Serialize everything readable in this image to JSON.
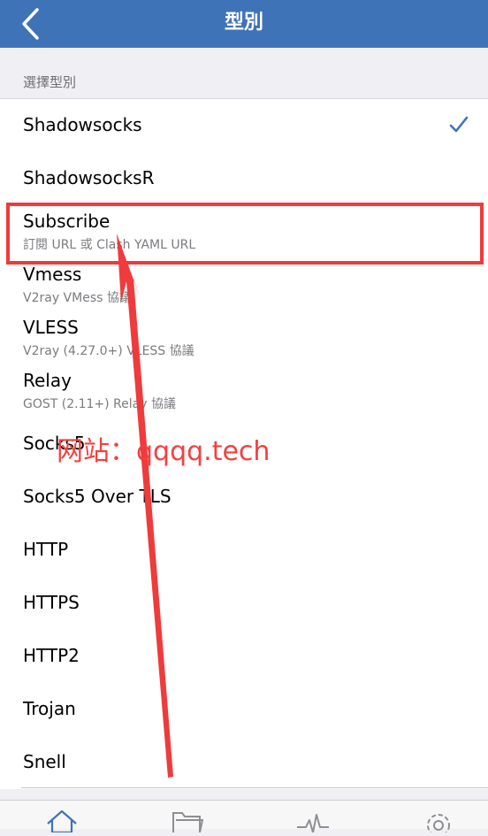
{
  "navbar": {
    "title": "型別",
    "back_icon": "chevron-left-icon"
  },
  "section": {
    "header": "選擇型別"
  },
  "types": [
    {
      "title": "Shadowsocks",
      "subtitle": "",
      "selected": true
    },
    {
      "title": "ShadowsocksR",
      "subtitle": ""
    },
    {
      "title": "Subscribe",
      "subtitle": "訂閱 URL 或 Clash YAML URL"
    },
    {
      "title": "Vmess",
      "subtitle": "V2ray VMess 協議"
    },
    {
      "title": "VLESS",
      "subtitle": "V2ray (4.27.0+) VLESS 協議"
    },
    {
      "title": "Relay",
      "subtitle": "GOST (2.11+) Relay 協議"
    },
    {
      "title": "Socks5",
      "subtitle": ""
    },
    {
      "title": "Socks5 Over TLS",
      "subtitle": ""
    },
    {
      "title": "HTTP",
      "subtitle": ""
    },
    {
      "title": "HTTPS",
      "subtitle": ""
    },
    {
      "title": "HTTP2",
      "subtitle": ""
    },
    {
      "title": "Trojan",
      "subtitle": ""
    },
    {
      "title": "Snell",
      "subtitle": ""
    }
  ],
  "tabbar": {
    "icons": [
      "home-icon",
      "folder-icon",
      "activity-icon",
      "gear-icon"
    ]
  },
  "annotation": {
    "watermark": "网站：qqqq.tech",
    "highlight_color": "#ef3b3b"
  },
  "colors": {
    "navbar": "#3e73b8",
    "check": "#3e73b8",
    "watermark": "#f2413f"
  }
}
